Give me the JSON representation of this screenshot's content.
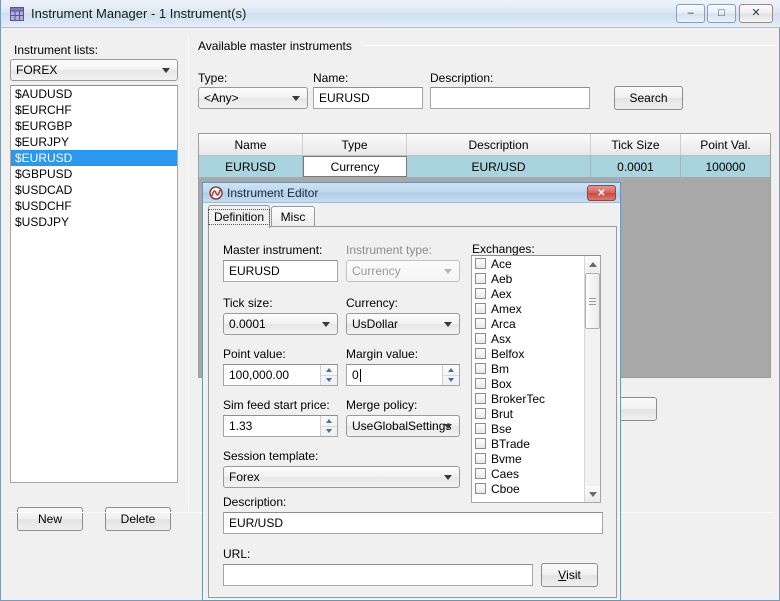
{
  "window": {
    "title": "Instrument Manager - 1 Instrument(s)",
    "icon": "grid-table-icon",
    "minimize_label": "–",
    "maximize_label": "□",
    "close_label": "✕"
  },
  "left_panel": {
    "lists_label": "Instrument lists:",
    "lists_selected": "FOREX",
    "instruments": [
      {
        "name": "$AUDUSD",
        "selected": false
      },
      {
        "name": "$EURCHF",
        "selected": false
      },
      {
        "name": "$EURGBP",
        "selected": false
      },
      {
        "name": "$EURJPY",
        "selected": false
      },
      {
        "name": "$EURUSD",
        "selected": true
      },
      {
        "name": "$GBPUSD",
        "selected": false
      },
      {
        "name": "$USDCAD",
        "selected": false
      },
      {
        "name": "$USDCHF",
        "selected": false
      },
      {
        "name": "$USDJPY",
        "selected": false
      }
    ],
    "new_button": "New",
    "delete_button": "Delete"
  },
  "right_panel": {
    "group_title": "Available master instruments",
    "type_label": "Type:",
    "type_value": "<Any>",
    "name_label": "Name:",
    "name_value": "EURUSD",
    "description_label": "Description:",
    "description_value": "",
    "description_placeholder": "",
    "search_button": "Search",
    "grid": {
      "columns": [
        "Name",
        "Type",
        "Description",
        "Tick Size",
        "Point Val."
      ],
      "rows": [
        {
          "Name": "EURUSD",
          "Type": "Currency",
          "Description": "EUR/USD",
          "Tick Size": "0.0001",
          "Point Val.": "100000",
          "selected": true,
          "editing_column": "Type"
        }
      ]
    }
  },
  "dialog": {
    "title": "Instrument Editor",
    "icon": "ninja-swirl-icon",
    "close_label": "✕",
    "tabs": [
      {
        "label": "Definition",
        "active": true
      },
      {
        "label": "Misc",
        "active": false
      }
    ],
    "fields": {
      "master_instrument_label": "Master instrument:",
      "master_instrument_value": "EURUSD",
      "instrument_type_label": "Instrument type:",
      "instrument_type_value": "Currency",
      "tick_size_label": "Tick size:",
      "tick_size_value": "0.0001",
      "currency_label": "Currency:",
      "currency_value": "UsDollar",
      "point_value_label": "Point value:",
      "point_value_value": "100,000.00",
      "margin_value_label": "Margin value:",
      "margin_value_value": "0",
      "sim_feed_label": "Sim feed start price:",
      "sim_feed_value": "1.33",
      "merge_policy_label": "Merge policy:",
      "merge_policy_value": "UseGlobalSettings",
      "session_template_label": "Session template:",
      "session_template_value": "Forex",
      "description_label": "Description:",
      "description_value": "EUR/USD",
      "url_label": "URL:",
      "url_value": "",
      "visit_button_prefix": "V",
      "visit_button_rest": "isit"
    },
    "exchanges_label": "Exchanges:",
    "exchanges": [
      "Ace",
      "Aeb",
      "Aex",
      "Amex",
      "Arca",
      "Asx",
      "Belfox",
      "Bm",
      "Box",
      "BrokerTec",
      "Brut",
      "Bse",
      "BTrade",
      "Bvme",
      "Caes",
      "Cboe"
    ]
  },
  "colors": {
    "selection_blue": "#2a97f0",
    "grid_row_selected": "#a9d4de",
    "dialog_title": "#bcd6ec",
    "close_red": "#c8493f",
    "window_bg": "#f0f0f0"
  }
}
